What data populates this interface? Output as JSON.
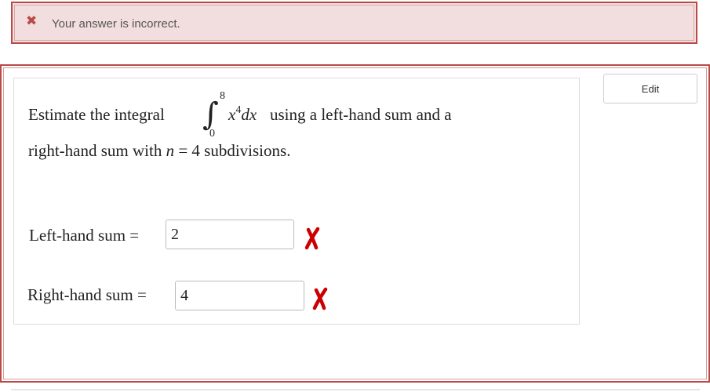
{
  "alert": {
    "icon": "close-icon",
    "icon_glyph": "✖",
    "message": "Your answer is incorrect."
  },
  "edit_button": {
    "label": "Edit"
  },
  "question": {
    "prefix": "Estimate the integral",
    "integral_upper": "8",
    "integral_lower": "0",
    "integrand_var": "x",
    "integrand_exp": "4",
    "integrand_diff": "dx",
    "suffix": "using a left-hand sum and a",
    "line2_a": "right-hand sum with ",
    "line2_n": "n",
    "line2_b": " = 4 subdivisions."
  },
  "answers": {
    "left": {
      "label": "Left-hand sum =",
      "value": "2",
      "status": "incorrect",
      "status_icon": "red-x-icon"
    },
    "right": {
      "label": "Right-hand sum =",
      "value": "4",
      "status": "incorrect",
      "status_icon": "red-x-icon"
    }
  },
  "colors": {
    "alert_bg": "#f2dede",
    "alert_border": "#b94a48",
    "error_red": "#cc0000"
  }
}
